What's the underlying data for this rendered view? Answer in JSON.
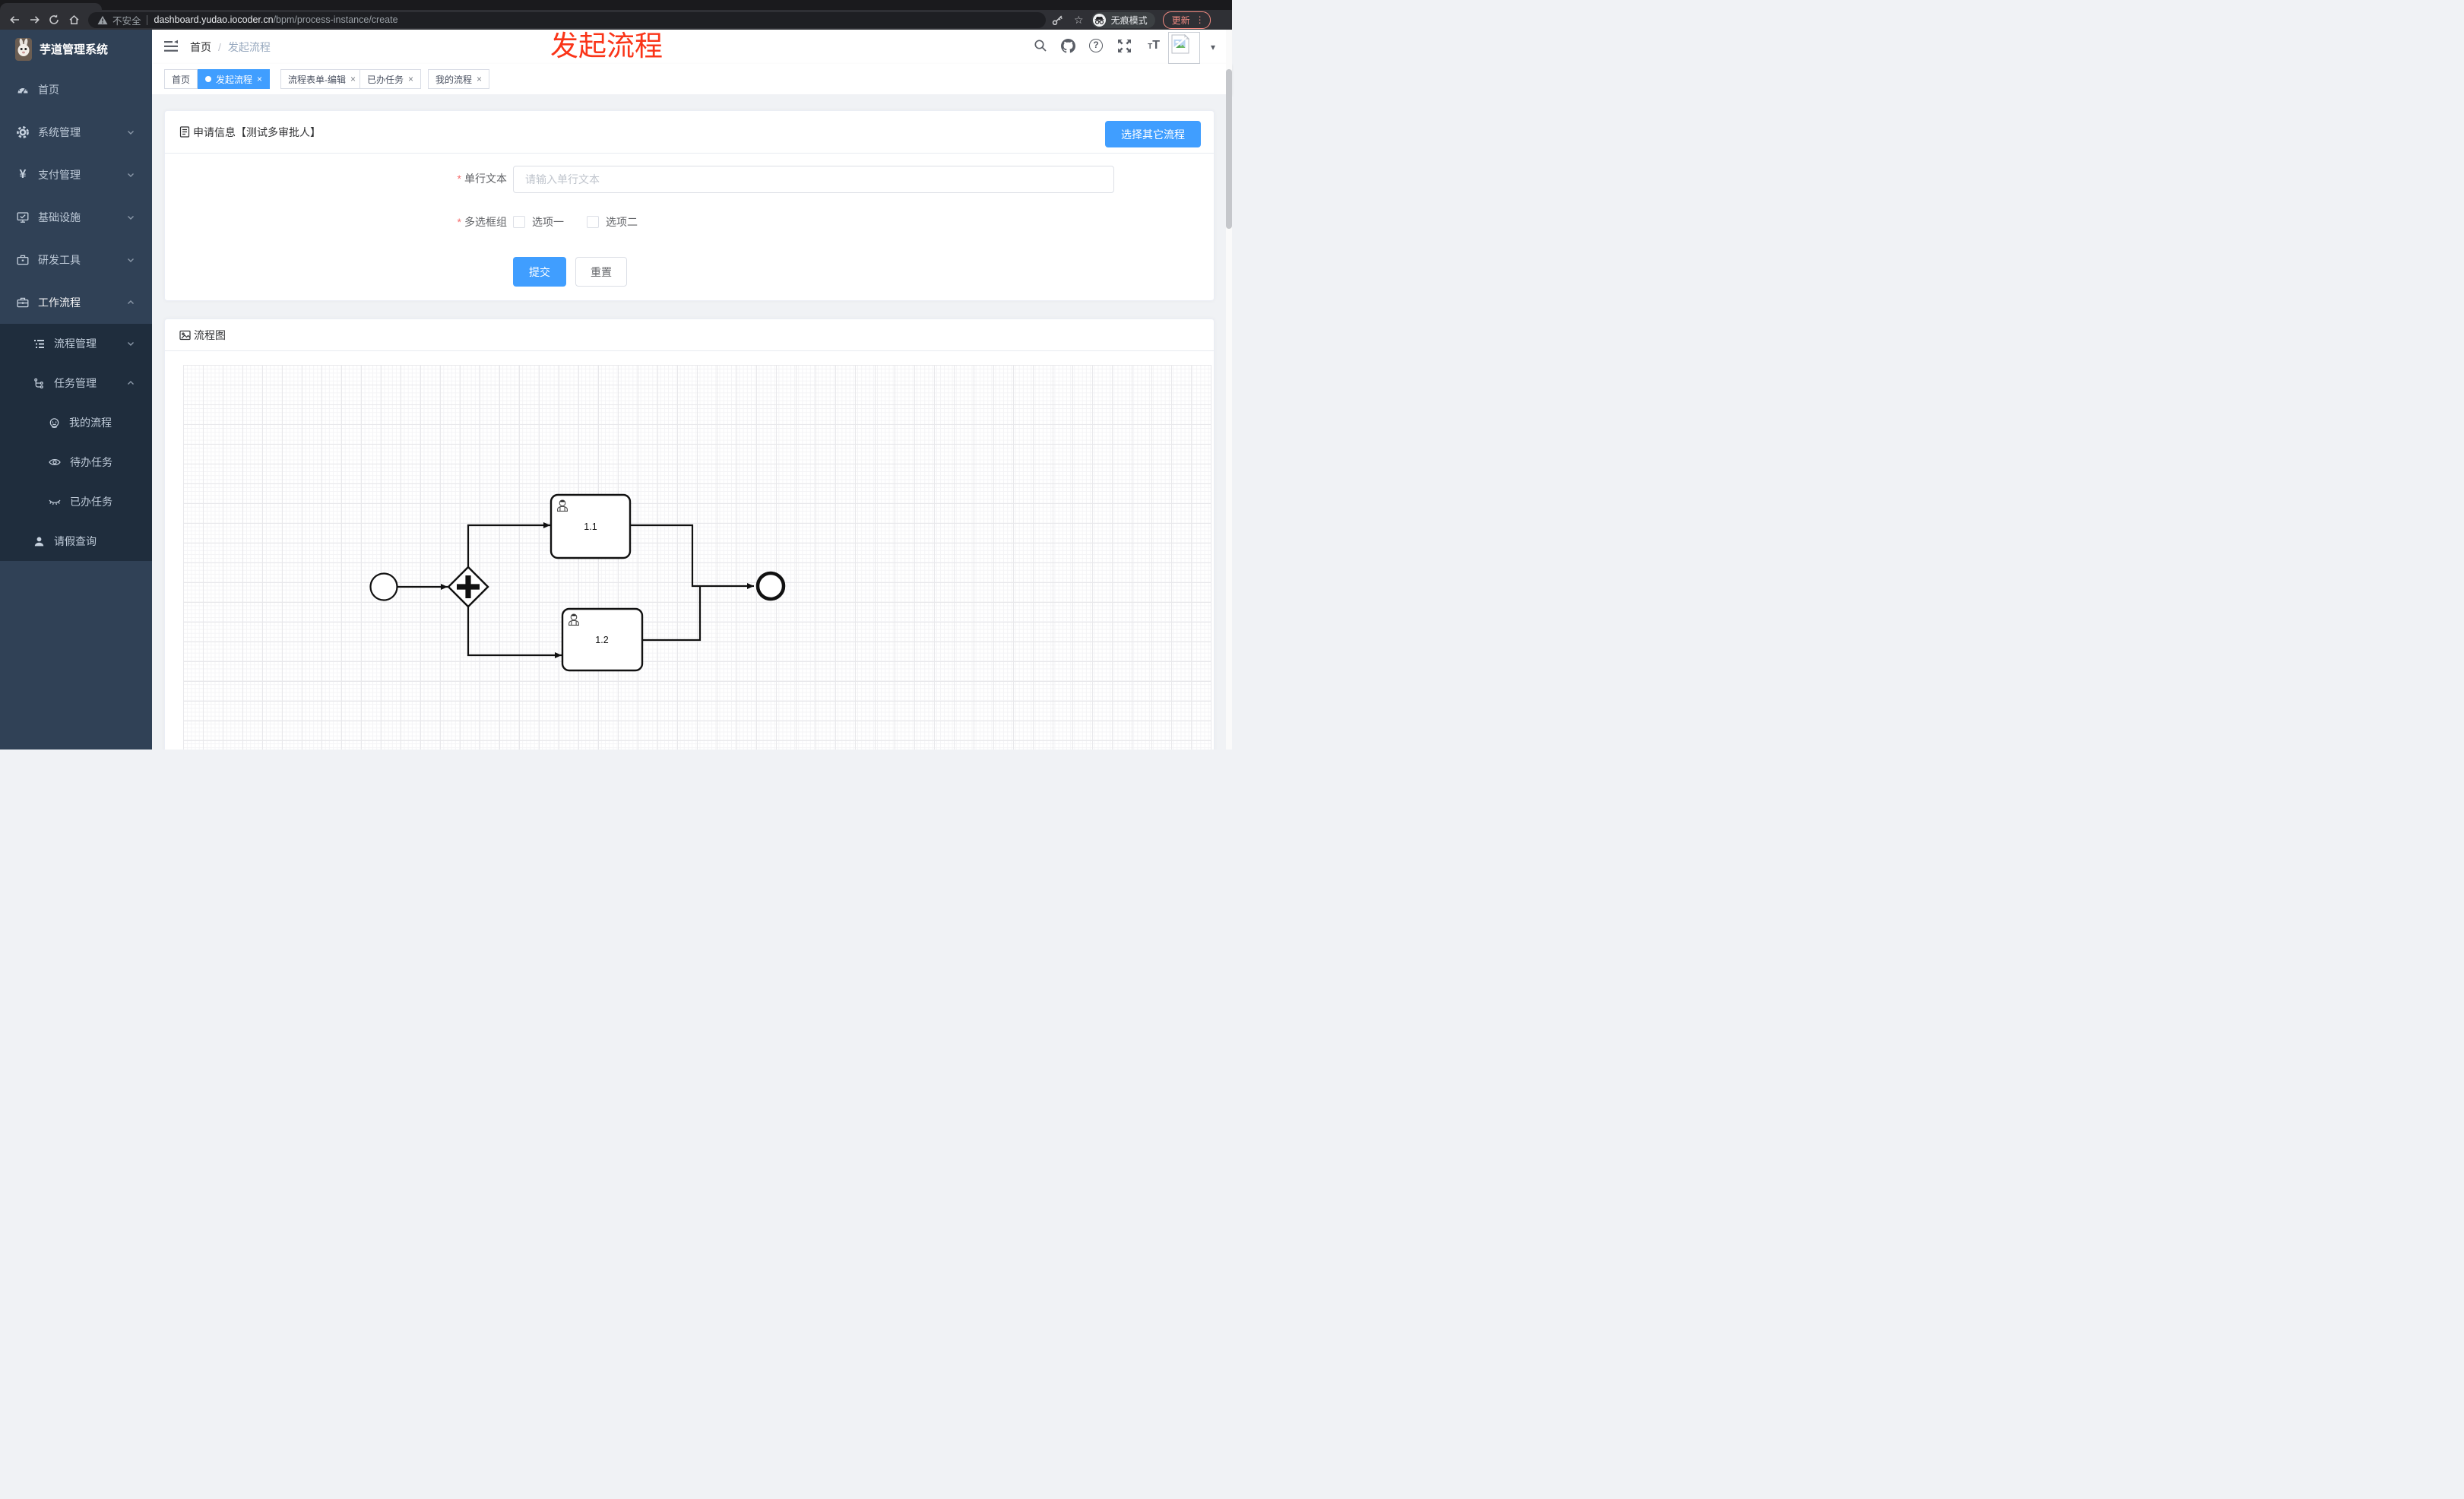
{
  "browser": {
    "security_label": "不安全",
    "url_host": "dashboard.yudao.iocoder.cn",
    "url_path": "/bpm/process-instance/create",
    "incognito_label": "无痕模式",
    "update_label": "更新"
  },
  "ui": {
    "close_glyph": "×",
    "dots_glyph": "⋮",
    "star_glyph": "☆",
    "caret_glyph": "▾",
    "breadcrumb_separator": "/",
    "required_glyph": "*",
    "question_glyph": "?",
    "yen_glyph": "¥",
    "font_glyph": "T"
  },
  "sidebar": {
    "app_title": "芋道管理系统",
    "items": [
      {
        "label": "首页",
        "icon": "dashboard-icon",
        "level": 1
      },
      {
        "label": "系统管理",
        "icon": "gear-icon",
        "level": 1,
        "arrow": "down"
      },
      {
        "label": "支付管理",
        "icon": "yen-icon",
        "level": 1,
        "arrow": "down"
      },
      {
        "label": "基础设施",
        "icon": "monitor-icon",
        "level": 1,
        "arrow": "down"
      },
      {
        "label": "研发工具",
        "icon": "toolbox-icon",
        "level": 1,
        "arrow": "down"
      },
      {
        "label": "工作流程",
        "icon": "briefcase-icon",
        "level": 1,
        "arrow": "up",
        "active": true
      },
      {
        "label": "流程管理",
        "icon": "list-tree-icon",
        "level": 2,
        "arrow": "down"
      },
      {
        "label": "任务管理",
        "icon": "tree-icon",
        "level": 2,
        "arrow": "up"
      },
      {
        "label": "我的流程",
        "icon": "face-icon",
        "level": 3
      },
      {
        "label": "待办任务",
        "icon": "eye-icon",
        "level": 3
      },
      {
        "label": "已办任务",
        "icon": "eye-closed-icon",
        "level": 3
      },
      {
        "label": "请假查询",
        "icon": "user-icon",
        "level": 2
      }
    ]
  },
  "header": {
    "breadcrumb": [
      "首页",
      "发起流程"
    ],
    "icons": [
      "search-icon",
      "github-icon",
      "question-icon",
      "fullscreen-icon",
      "font-size-icon"
    ]
  },
  "tabs": [
    {
      "label": "首页",
      "active": false,
      "closable": false
    },
    {
      "label": "发起流程",
      "active": true,
      "closable": true
    },
    {
      "label": "流程表单-编辑",
      "active": false,
      "closable": true
    },
    {
      "label": "已办任务",
      "active": false,
      "closable": true
    },
    {
      "label": "我的流程",
      "active": false,
      "closable": true
    }
  ],
  "annotation": {
    "text": "发起流程"
  },
  "form_card": {
    "title": "申请信息【测试多审批人】",
    "action_button": "选择其它流程",
    "fields": [
      {
        "label": "单行文本",
        "required": true,
        "type": "input",
        "placeholder": "请输入单行文本",
        "value": ""
      },
      {
        "label": "多选框组",
        "required": true,
        "type": "checkbox-group",
        "options": [
          {
            "label": "选项一",
            "checked": false
          },
          {
            "label": "选项二",
            "checked": false
          }
        ]
      }
    ],
    "submit_label": "提交",
    "reset_label": "重置"
  },
  "diagram_card": {
    "title": "流程图",
    "nodes": [
      {
        "type": "start-event"
      },
      {
        "type": "parallel-gateway"
      },
      {
        "type": "user-task",
        "label": "1.1"
      },
      {
        "type": "user-task",
        "label": "1.2"
      },
      {
        "type": "end-event"
      }
    ]
  },
  "colors": {
    "accent": "#409eff",
    "annotation_red": "#fa3418",
    "sidebar_bg": "#304156",
    "submenu_bg": "#1f2d3d"
  }
}
